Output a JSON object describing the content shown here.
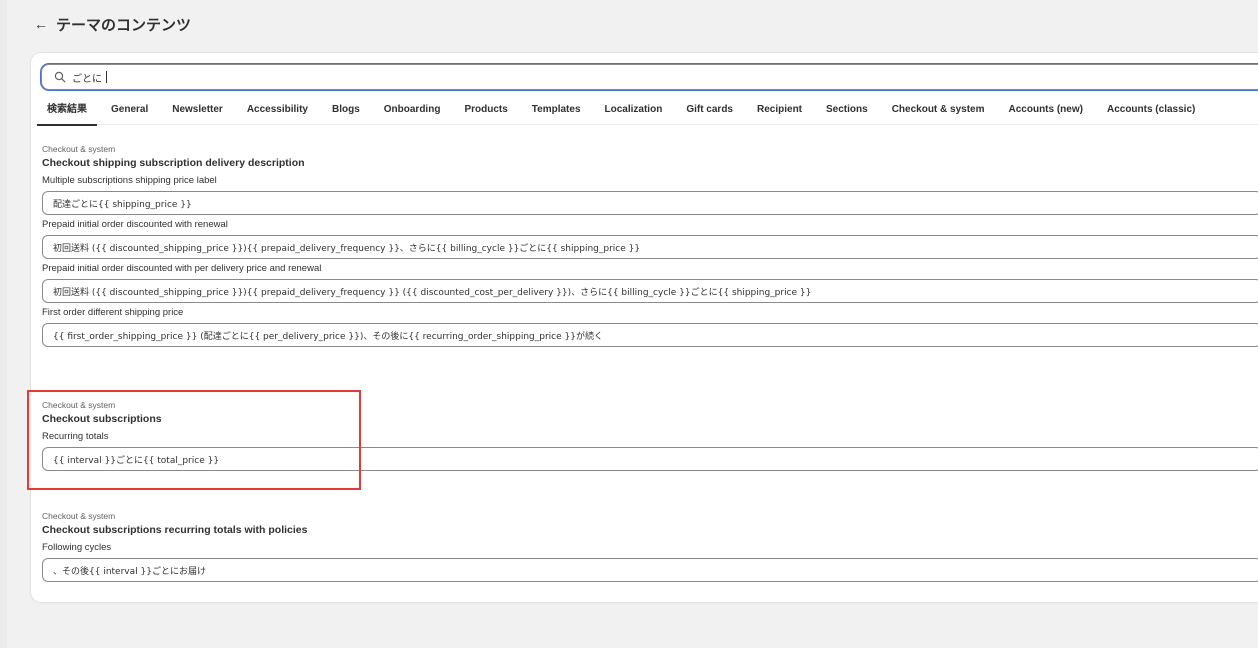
{
  "header": {
    "back_icon": "←",
    "title": "テーマのコンテンツ"
  },
  "search": {
    "value": "ごとに",
    "icon": "search-icon"
  },
  "tabs": [
    {
      "label": "検索結果",
      "active": true
    },
    {
      "label": "General"
    },
    {
      "label": "Newsletter"
    },
    {
      "label": "Accessibility"
    },
    {
      "label": "Blogs"
    },
    {
      "label": "Onboarding"
    },
    {
      "label": "Products"
    },
    {
      "label": "Templates"
    },
    {
      "label": "Localization"
    },
    {
      "label": "Gift cards"
    },
    {
      "label": "Recipient"
    },
    {
      "label": "Sections"
    },
    {
      "label": "Checkout & system"
    },
    {
      "label": "Accounts (new)"
    },
    {
      "label": "Accounts (classic)"
    }
  ],
  "sections": [
    {
      "category": "Checkout & system",
      "title": "Checkout shipping subscription delivery description",
      "fields": [
        {
          "label": "Multiple subscriptions shipping price label",
          "value": "配達ごとに{{ shipping_price }}"
        },
        {
          "label": "Prepaid initial order discounted with renewal",
          "value": "初回送料 ({{ discounted_shipping_price }}){{ prepaid_delivery_frequency }}、さらに{{ billing_cycle }}ごとに{{ shipping_price }}"
        },
        {
          "label": "Prepaid initial order discounted with per delivery price and renewal",
          "value": "初回送料 ({{ discounted_shipping_price }}){{ prepaid_delivery_frequency }} ({{ discounted_cost_per_delivery }})、さらに{{ billing_cycle }}ごとに{{ shipping_price }}"
        },
        {
          "label": "First order different shipping price",
          "value": "{{ first_order_shipping_price }} (配達ごとに{{ per_delivery_price }})、その後に{{ recurring_order_shipping_price }}が続く"
        }
      ]
    },
    {
      "category": "Checkout & system",
      "title": "Checkout subscriptions",
      "fields": [
        {
          "label": "Recurring totals",
          "value": "{{ interval }}ごとに{{ total_price }}"
        }
      ]
    },
    {
      "category": "Checkout & system",
      "title": "Checkout subscriptions recurring totals with policies",
      "fields": [
        {
          "label": "Following cycles",
          "value": "、その後{{ interval }}ごとにお届け"
        }
      ]
    }
  ],
  "colors": {
    "highlight": "#e53935",
    "focus_ring": "#4a6fd1"
  }
}
